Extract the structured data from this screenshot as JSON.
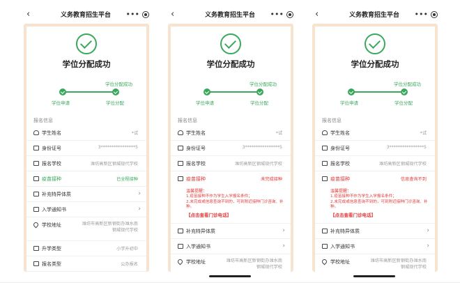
{
  "header": {
    "title": "义务教育招生平台",
    "back_icon": "chevron-left-icon",
    "more_icon": "more-dots-icon",
    "target_icon": "target-icon"
  },
  "result": {
    "title": "学位分配成功",
    "icon": "check-circle-icon"
  },
  "steps": {
    "top_label": "学位分配成功",
    "step1": "学位申请",
    "step2": "学位分配"
  },
  "section_title": "报名信息",
  "colors": {
    "accent": "#3aa85b",
    "warning": "#e03a3a",
    "frame": "#f7e3ce"
  },
  "screens": [
    {
      "rows": [
        {
          "label": "学生姓名",
          "value": "*试",
          "icon": "person-icon"
        },
        {
          "label": "身份证号",
          "value": "3****************5",
          "icon": "id-card-icon"
        },
        {
          "label": "报名学校",
          "value": "潍坊高新区钢城现代学校",
          "icon": "school-icon"
        },
        {
          "label": "疫苗接种",
          "value": "已全程接种",
          "icon": "vaccine-icon"
        },
        {
          "label": "补充特异体质",
          "value": "",
          "icon": "doc-icon"
        },
        {
          "label": "入学通知书",
          "value": "",
          "icon": "notice-icon"
        },
        {
          "label": "学校地址",
          "value": "潍坊市高新区新钢街办潍水南钢城现代学校",
          "icon": "location-icon"
        },
        {
          "label": "升学类型",
          "value": "小学升初中",
          "icon": "type-icon"
        },
        {
          "label": "报名类型",
          "value": "公办报名",
          "icon": "type-icon"
        }
      ]
    },
    {
      "rows": [
        {
          "label": "学生姓名",
          "value": "*试",
          "icon": "person-icon"
        },
        {
          "label": "身份证号",
          "value": "3****************5",
          "icon": "id-card-icon"
        },
        {
          "label": "报名学校",
          "value": "潍坊高新区钢城现代学校",
          "icon": "school-icon"
        },
        {
          "label": "疫苗接种",
          "value": "未完成接种",
          "icon": "vaccine-icon"
        }
      ],
      "notice": {
        "title": "温馨提醒：",
        "line1": "1.疫苗接种不作为学生入学报名条件；",
        "line2": "2.未完成或信息查询不到的，可到附近接种门诊咨询、补种。",
        "link": "【点击查看门诊电话】"
      },
      "rows_after": [
        {
          "label": "补充特异体质",
          "value": "",
          "icon": "doc-icon"
        },
        {
          "label": "入学通知书",
          "value": "",
          "icon": "notice-icon"
        },
        {
          "label": "学校地址",
          "value": "潍坊市高新区新钢街办潍水南钢城现代学校",
          "icon": "location-icon"
        }
      ]
    },
    {
      "rows": [
        {
          "label": "学生姓名",
          "value": "*试",
          "icon": "person-icon"
        },
        {
          "label": "身份证号",
          "value": "3****************5",
          "icon": "id-card-icon"
        },
        {
          "label": "报名学校",
          "value": "潍坊高新区钢城现代学校",
          "icon": "school-icon"
        },
        {
          "label": "疫苗接种",
          "value": "信息查询不到",
          "icon": "vaccine-icon"
        }
      ],
      "notice": {
        "title": "温馨提醒：",
        "line1": "1.疫苗接种不作为学生入学报名条件；",
        "line2": "2.未完成或信息查询不到的，可到附近接种门诊咨询、补种。",
        "link": "【点击查看门诊电话】"
      },
      "rows_after": [
        {
          "label": "补充特异体质",
          "value": "",
          "icon": "doc-icon"
        },
        {
          "label": "入学通知书",
          "value": "",
          "icon": "notice-icon"
        },
        {
          "label": "学校地址",
          "value": "潍坊市高新区新钢街办潍水南钢城现代学校",
          "icon": "location-icon"
        }
      ]
    }
  ]
}
